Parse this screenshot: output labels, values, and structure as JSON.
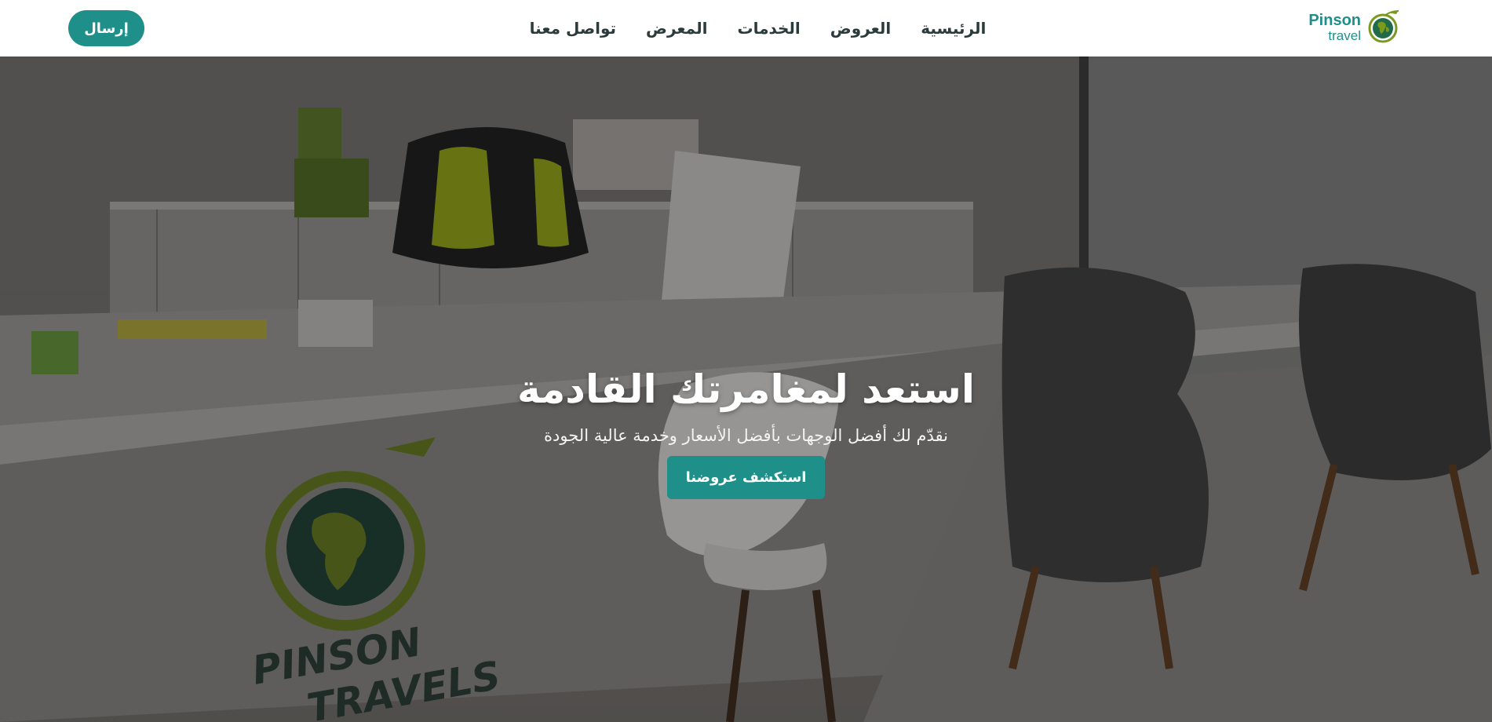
{
  "header": {
    "send_button": "إرسال",
    "nav": [
      {
        "label": "الرئيسية"
      },
      {
        "label": "العروض"
      },
      {
        "label": "الخدمات"
      },
      {
        "label": "المعرض"
      },
      {
        "label": "تواصل معنا"
      }
    ],
    "logo": {
      "name": "Pinson",
      "sub": "travel",
      "icon": "globe-plane-icon"
    }
  },
  "hero": {
    "title": "استعد لمغامرتك القادمة",
    "subtitle": "نقدّم لك أفضل الوجهات بأفضل الأسعار وخدمة عالية الجودة",
    "cta": "استكشف عروضنا",
    "background": "office-interior-photo",
    "desk_logo": {
      "line1": "PINSON",
      "line2": "TRAVELS"
    }
  },
  "colors": {
    "accent": "#1f8f8a",
    "logo_green": "#7a9a1e",
    "nav_text": "#2b3a3a"
  }
}
